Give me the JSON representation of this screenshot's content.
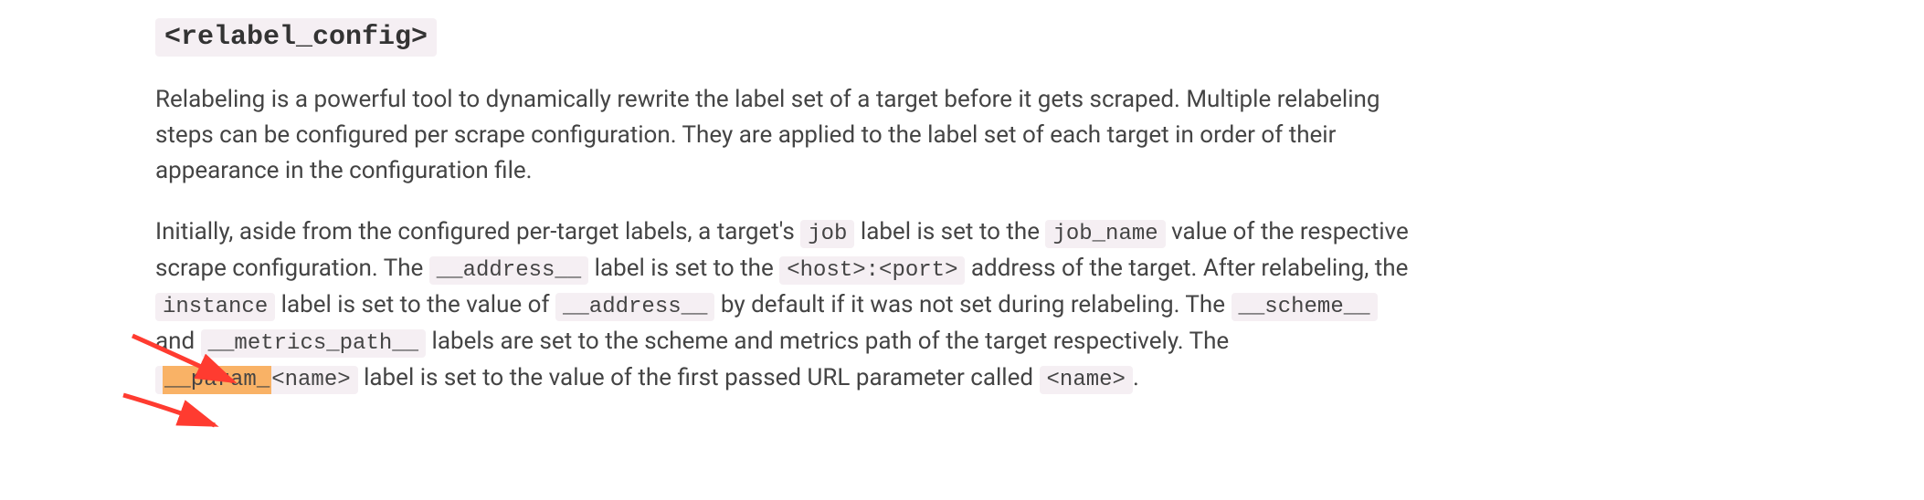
{
  "heading": "<relabel_config>",
  "para1": "Relabeling is a powerful tool to dynamically rewrite the label set of a target before it gets scraped. Multiple relabeling steps can be configured per scrape configuration. They are applied to the label set of each target in order of their appearance in the configuration file.",
  "para2": {
    "t1": "Initially, aside from the configured per-target labels, a target's ",
    "c1": "job",
    "t2": " label is set to the ",
    "c2": "job_name",
    "t3": " value of the respective scrape configuration. The ",
    "c3": "__address__",
    "t4": " label is set to the ",
    "c4": "<host>:<port>",
    "t5": " address of the target. After relabeling, the ",
    "c5": "instance",
    "t6": " label is set to the value of ",
    "c6": "__address__",
    "t7": " by default if it was not set during relabeling. The ",
    "c7": "__scheme__",
    "t8": " and ",
    "c8": "__metrics_path__",
    "t9": " labels are set to the scheme and metrics path of the target respectively. The ",
    "c9_highlight": "__param_",
    "c9_rest": "<name>",
    "t10": " label is set to the value of the first passed URL parameter called ",
    "c10": "<name>",
    "t11": "."
  }
}
